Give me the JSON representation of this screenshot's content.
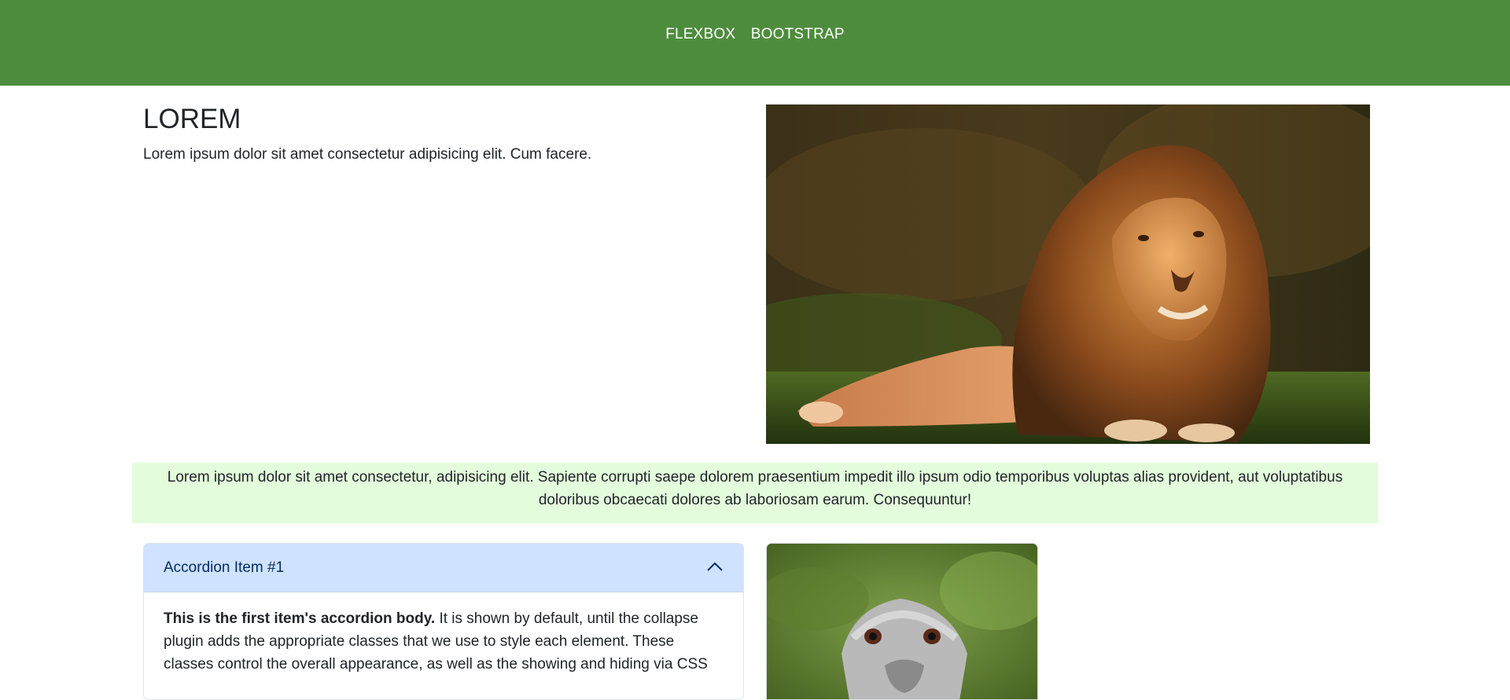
{
  "nav": {
    "items": [
      "FLEXBOX",
      "BOOTSTRAP"
    ]
  },
  "hero": {
    "title": "LOREM",
    "text": "Lorem ipsum dolor sit amet consectetur adipisicing elit. Cum facere.",
    "image_alt": "lion lying on grass"
  },
  "band": {
    "text": "Lorem ipsum dolor sit amet consectetur, adipisicing elit. Sapiente corrupti saepe dolorem praesentium impedit illo ipsum odio temporibus voluptas alias provident, aut voluptatibus doloribus obcaecati dolores ab laboriosam earum. Consequuntur!"
  },
  "accordion": {
    "item1": {
      "header": "Accordion Item #1",
      "body_strong": "This is the first item's accordion body.",
      "body_rest": " It is shown by default, until the collapse plugin adds the appropriate classes that we use to style each element. These classes control the overall appearance, as well as the showing and hiding via CSS"
    }
  },
  "card": {
    "image_alt": "ostrich head"
  },
  "colors": {
    "topbar": "#4e8c3d",
    "band": "#e3fcdc",
    "accordion_header": "#cfe2ff"
  }
}
